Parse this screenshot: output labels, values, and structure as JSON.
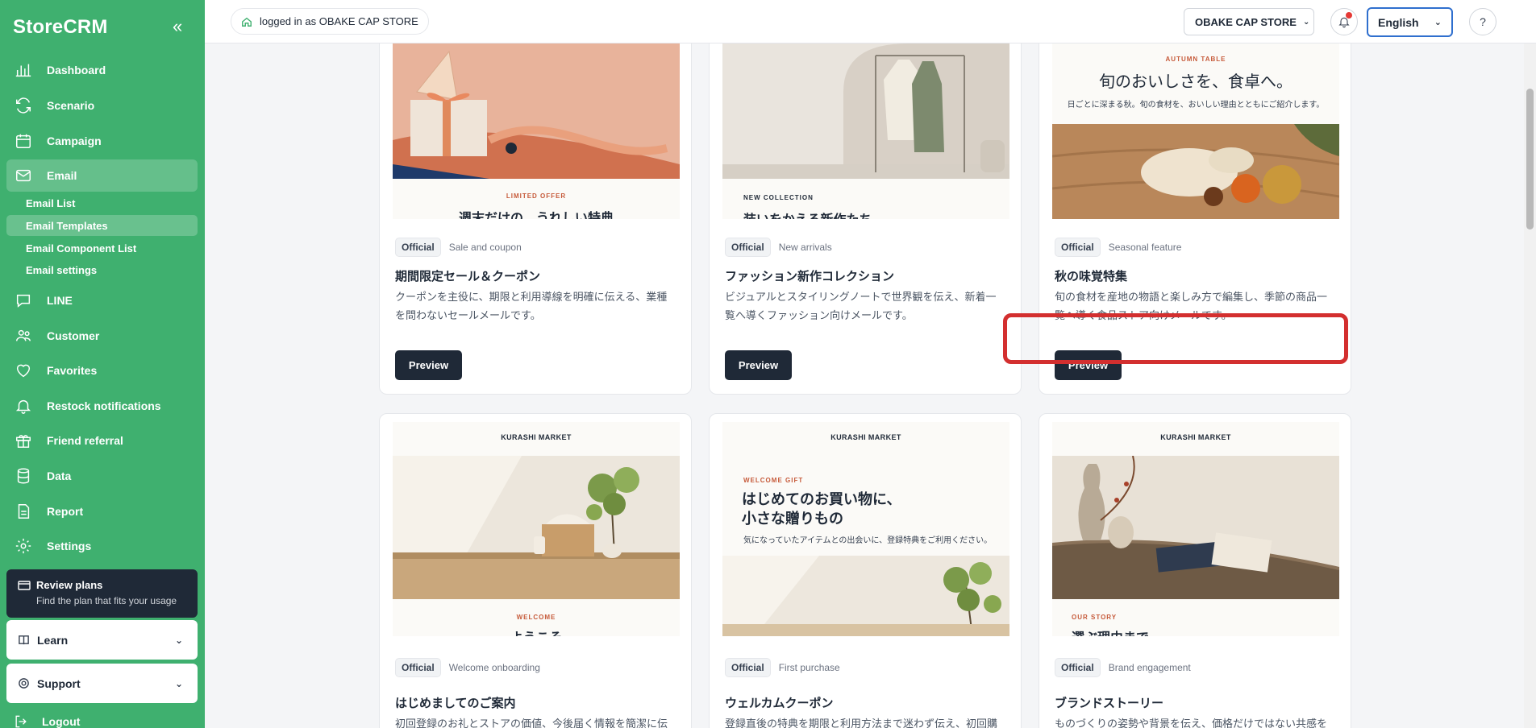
{
  "app": {
    "brand": "StoreCRM"
  },
  "sidebar": {
    "items": [
      {
        "label": "Dashboard",
        "icon": "chart-icon"
      },
      {
        "label": "Scenario",
        "icon": "refresh-icon"
      },
      {
        "label": "Campaign",
        "icon": "calendar-icon"
      },
      {
        "label": "Email",
        "icon": "mail-icon"
      },
      {
        "label": "LINE",
        "icon": "chat-icon"
      },
      {
        "label": "Customer",
        "icon": "users-icon"
      },
      {
        "label": "Favorites",
        "icon": "heart-icon"
      },
      {
        "label": "Restock notifications",
        "icon": "bell-icon"
      },
      {
        "label": "Friend referral",
        "icon": "gift-icon"
      },
      {
        "label": "Data",
        "icon": "database-icon"
      },
      {
        "label": "Report",
        "icon": "file-icon"
      },
      {
        "label": "Settings",
        "icon": "gear-icon"
      }
    ],
    "email_sub": [
      "Email List",
      "Email Templates",
      "Email Component List",
      "Email settings"
    ],
    "review": {
      "title": "Review plans",
      "subtitle": "Find the plan that fits your usage"
    },
    "learn": "Learn",
    "support": "Support",
    "logout": "Logout"
  },
  "topbar": {
    "logged_prefix": "logged in as",
    "store": "OBAKE CAP STORE",
    "store_select": "OBAKE CAP STORE",
    "language": "English"
  },
  "templates": [
    {
      "badge": "Official",
      "category": "Sale and coupon",
      "title": "期間限定セール＆クーポン",
      "desc": "クーポンを主役に、期限と利用導線を明確に伝える、業種を問わないセールメールです。",
      "preview": "Preview",
      "thumb": {
        "kicker": "LIMITED OFFER",
        "heading": "週末だけの、うれしい特典"
      }
    },
    {
      "badge": "Official",
      "category": "New arrivals",
      "title": "ファッション新作コレクション",
      "desc": "ビジュアルとスタイリングノートで世界観を伝え、新着一覧へ導くファッション向けメールです。",
      "preview": "Preview",
      "thumb": {
        "kicker": "NEW COLLECTION",
        "heading": "装いをかえる新作たち"
      }
    },
    {
      "badge": "Official",
      "category": "Seasonal feature",
      "title": "秋の味覚特集",
      "desc": "旬の食材を産地の物語と楽しみ方で編集し、季節の商品一覧へ導く食品ストア向けメールです。",
      "preview": "Preview",
      "thumb": {
        "kicker": "AUTUMN TABLE",
        "heading": "旬のおいしさを、食卓へ。",
        "sub": "日ごとに深まる秋。旬の食材を、おいしい理由とともにご紹介します。"
      }
    },
    {
      "badge": "Official",
      "category": "Welcome onboarding",
      "title": "はじめましてのご案内",
      "desc": "初回登録のお礼とストアの価値、今後届く情報を簡潔に伝える",
      "preview": "Preview",
      "thumb": {
        "store": "KURASHI MARKET",
        "kicker": "WELCOME",
        "heading": "ようこそ"
      }
    },
    {
      "badge": "Official",
      "category": "First purchase",
      "title": "ウェルカムクーポン",
      "desc": "登録直後の特典を期限と利用方法まで迷わず伝え、初回購入",
      "preview": "Preview",
      "thumb": {
        "store": "KURASHI MARKET",
        "kicker": "WELCOME GIFT",
        "heading1": "はじめてのお買い物に、",
        "heading2": "小さな贈りもの",
        "sub": "気になっていたアイテムとの出会いに、登録特典をご利用ください。"
      }
    },
    {
      "badge": "Official",
      "category": "Brand engagement",
      "title": "ブランドストーリー",
      "desc": "ものづくりの姿勢や背景を伝え、価格だけではない共感を育てる",
      "preview": "Preview",
      "thumb": {
        "store": "KURASHI MARKET",
        "kicker": "OUR STORY",
        "heading": "選ぶ理由まで"
      }
    }
  ],
  "colors": {
    "sidebar": "#3fb06f",
    "dark_button": "#1f2937",
    "highlight": "#d32f2f",
    "language_border": "#2f6fce"
  }
}
